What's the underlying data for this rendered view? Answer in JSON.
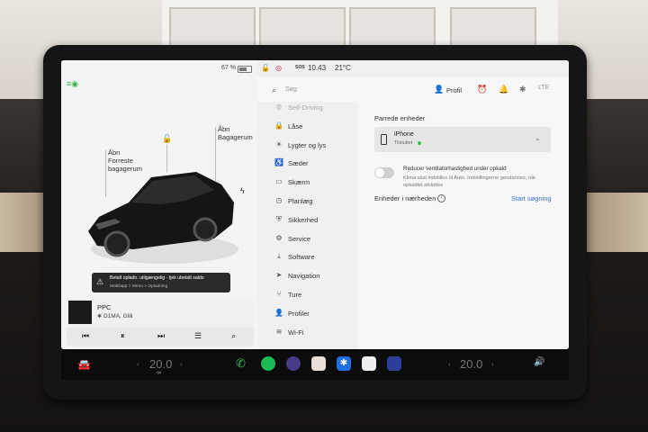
{
  "left": {
    "battery_pct": "67 %",
    "battery_level": 0.67,
    "open_front_label": "Åbn Forreste bagagerum",
    "open_front_line1": "Åbn",
    "open_front_line2": "Forreste",
    "open_front_line3": "bagagerum",
    "open_rear_line1": "Åbn",
    "open_rear_line2": "Bagagerum",
    "alert_title": "Betalt opladn. utilgængelig - tjek ubetalt saldo",
    "alert_sub": "Mobilapp > Menu > Opladning"
  },
  "media": {
    "title": "PPC",
    "artist": "D1MA, Gilli"
  },
  "status": {
    "sos": "SOS",
    "time": "10.43",
    "temp": "21°C"
  },
  "topbar": {
    "search_placeholder": "Søg",
    "profile": "Profil"
  },
  "menu": {
    "items": [
      {
        "label": "Self-Driving",
        "icon": "steering-icon"
      },
      {
        "label": "Låse",
        "icon": "lock-icon"
      },
      {
        "label": "Lygter og lys",
        "icon": "light-icon"
      },
      {
        "label": "Sæder",
        "icon": "seat-icon"
      },
      {
        "label": "Skærm",
        "icon": "display-icon"
      },
      {
        "label": "Planlæg",
        "icon": "clock-icon"
      },
      {
        "label": "Sikkerhed",
        "icon": "shield-icon"
      },
      {
        "label": "Service",
        "icon": "wrench-icon"
      },
      {
        "label": "Software",
        "icon": "download-icon"
      },
      {
        "label": "Navigation",
        "icon": "navigation-icon"
      },
      {
        "label": "Ture",
        "icon": "trips-icon"
      },
      {
        "label": "Profiler",
        "icon": "profile-icon"
      },
      {
        "label": "Wi-Fi",
        "icon": "wifi-icon"
      }
    ]
  },
  "bluetooth": {
    "paired_heading": "Parrede enheder",
    "device_name": "iPhone",
    "device_status": "Tilsluttet",
    "toggle_title": "Reducer ventilatorhastighed under opkald",
    "toggle_desc": "Klima skal indstilles til Auto. Indstillingerne gendannes, når opkaldet afsluttes",
    "nearby_heading": "Enheder i nærheden",
    "start_search": "Start søgning"
  },
  "dock": {
    "temp_left": "20.0",
    "temp_right": "20.0"
  },
  "colors": {
    "accent": "#3a72d8",
    "connected": "#3cbf4d",
    "alert_bg": "#2a2a2a"
  }
}
